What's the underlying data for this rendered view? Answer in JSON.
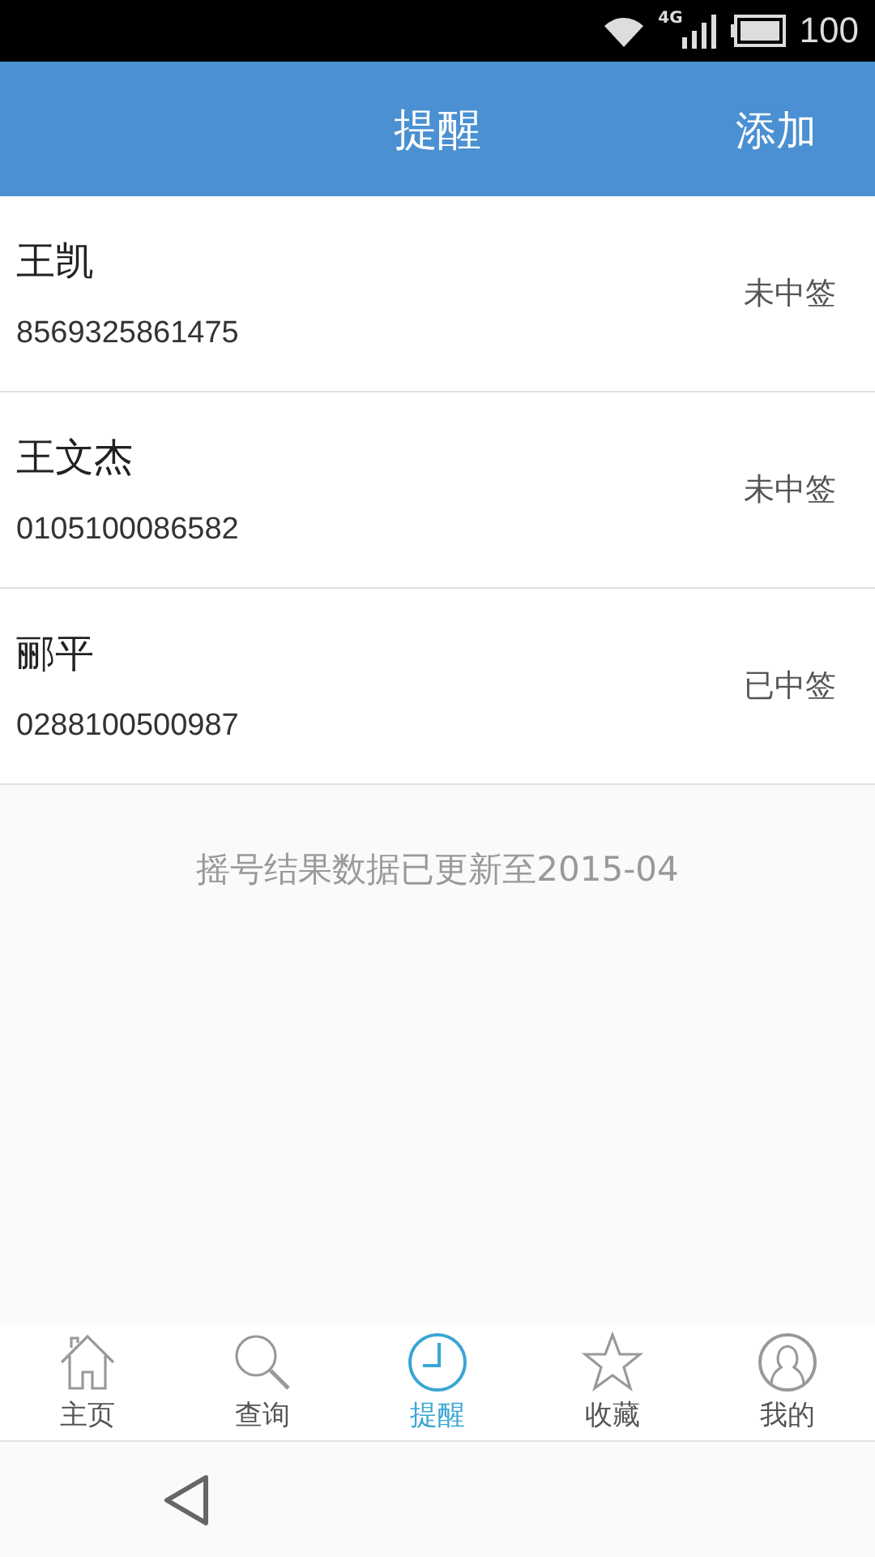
{
  "status_bar": {
    "network": "4G",
    "battery": "100"
  },
  "header": {
    "title": "提醒",
    "action": "添加"
  },
  "records": [
    {
      "name": "王凯",
      "number": "8569325861475",
      "status": "未中签"
    },
    {
      "name": "王文杰",
      "number": "0105100086582",
      "status": "未中签"
    },
    {
      "name": "郦平",
      "number": "0288100500987",
      "status": "已中签"
    }
  ],
  "notice": "摇号结果数据已更新至2015-04",
  "tabs": [
    {
      "kind": "home",
      "label": "主页",
      "selected": false
    },
    {
      "kind": "search",
      "label": "查询",
      "selected": false
    },
    {
      "kind": "clock",
      "label": "提醒",
      "selected": true
    },
    {
      "kind": "star",
      "label": "收藏",
      "selected": false
    },
    {
      "kind": "user",
      "label": "我的",
      "selected": false
    }
  ]
}
